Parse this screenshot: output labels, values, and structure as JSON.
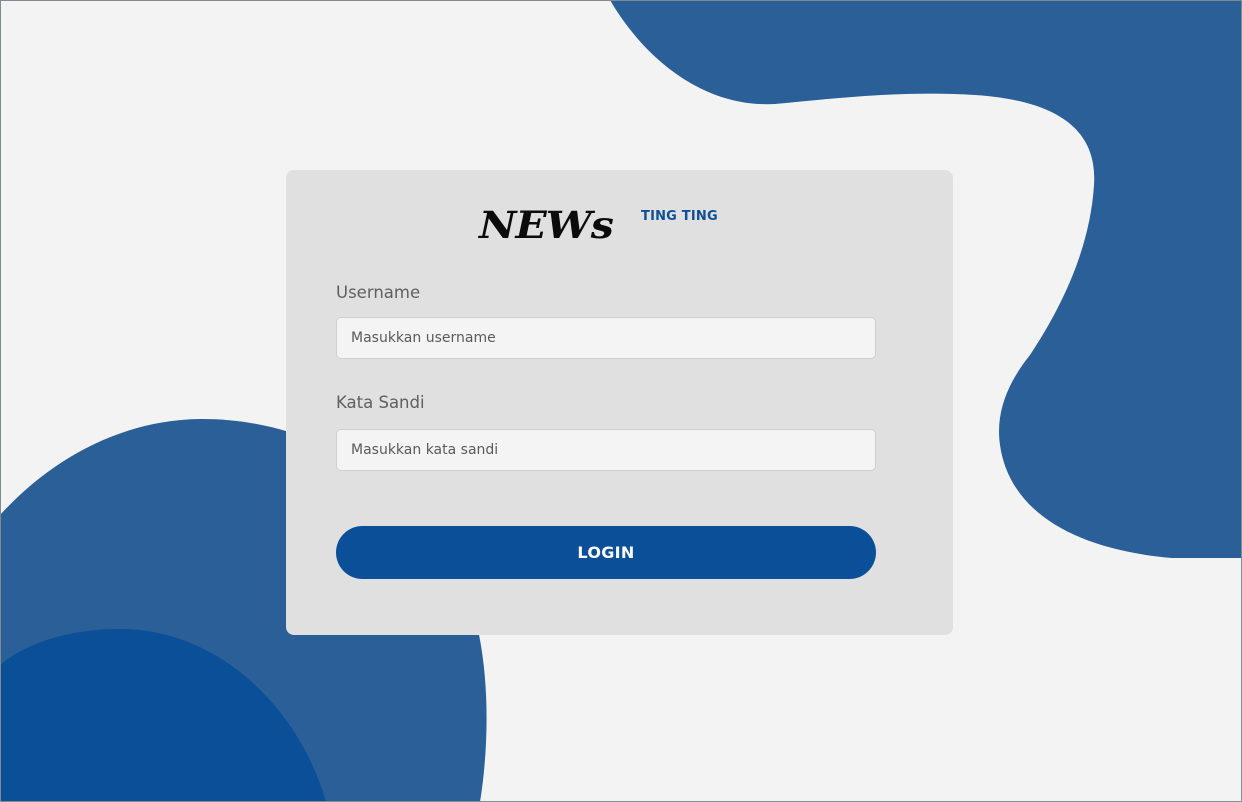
{
  "brand": {
    "name": "NEWs",
    "tagline": "TING TING"
  },
  "form": {
    "username_label": "Username",
    "username_placeholder": "Masukkan username",
    "password_label": "Kata Sandi",
    "password_placeholder": "Masukkan kata sandi",
    "login_label": "LOGIN"
  },
  "colors": {
    "background": "#f3f3f3",
    "blob_primary": "#2a5f98",
    "blob_dark": "#0b4f99",
    "card": "#e0e0e0",
    "button": "#0b4f99",
    "tagline": "#0f4f98"
  }
}
